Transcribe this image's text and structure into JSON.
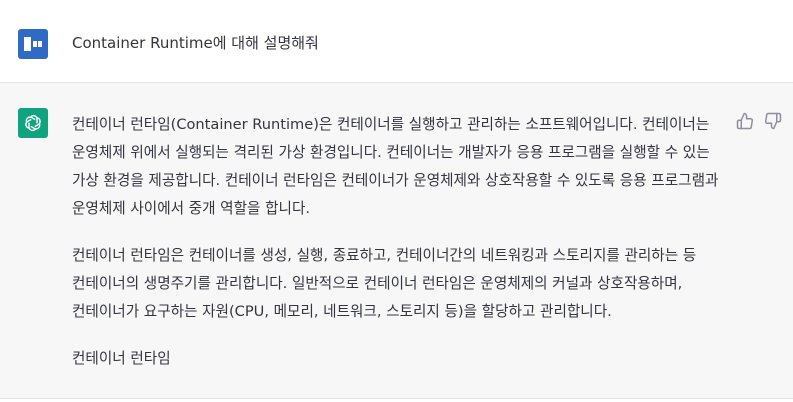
{
  "conversation": {
    "user_message": {
      "avatar_icon": "user-avatar-icon",
      "text": "Container Runtime에 대해 설명해줘"
    },
    "assistant_message": {
      "avatar_icon": "openai-logo-icon",
      "paragraphs": [
        "컨테이너 런타임(Container Runtime)은 컨테이너를 실행하고 관리하는 소프트웨어입니다. 컨테이너는 운영체제 위에서 실행되는 격리된 가상 환경입니다. 컨테이너는 개발자가 응용 프로그램을 실행할 수 있는 가상 환경을 제공합니다. 컨테이너 런타임은 컨테이너가 운영체제와 상호작용할 수 있도록 응용 프로그램과 운영체제 사이에서 중개 역할을 합니다.",
        "컨테이너 런타임은 컨테이너를 생성, 실행, 종료하고, 컨테이너간의 네트워킹과 스토리지를 관리하는 등 컨테이너의 생명주기를 관리합니다. 일반적으로 컨테이너 런타임은 운영체제의 커널과 상호작용하며, 컨테이너가 요구하는 자원(CPU, 메모리, 네트워크, 스토리지 등)을 할당하고 관리합니다.",
        "컨테이너 런타임"
      ],
      "actions": [
        "thumbs-up-icon",
        "thumbs-down-icon"
      ]
    }
  },
  "colors": {
    "user_avatar": "#2f6bc4",
    "assistant_avatar": "#10a37f",
    "assistant_background": "#f7f7f8",
    "text": "#343541"
  }
}
